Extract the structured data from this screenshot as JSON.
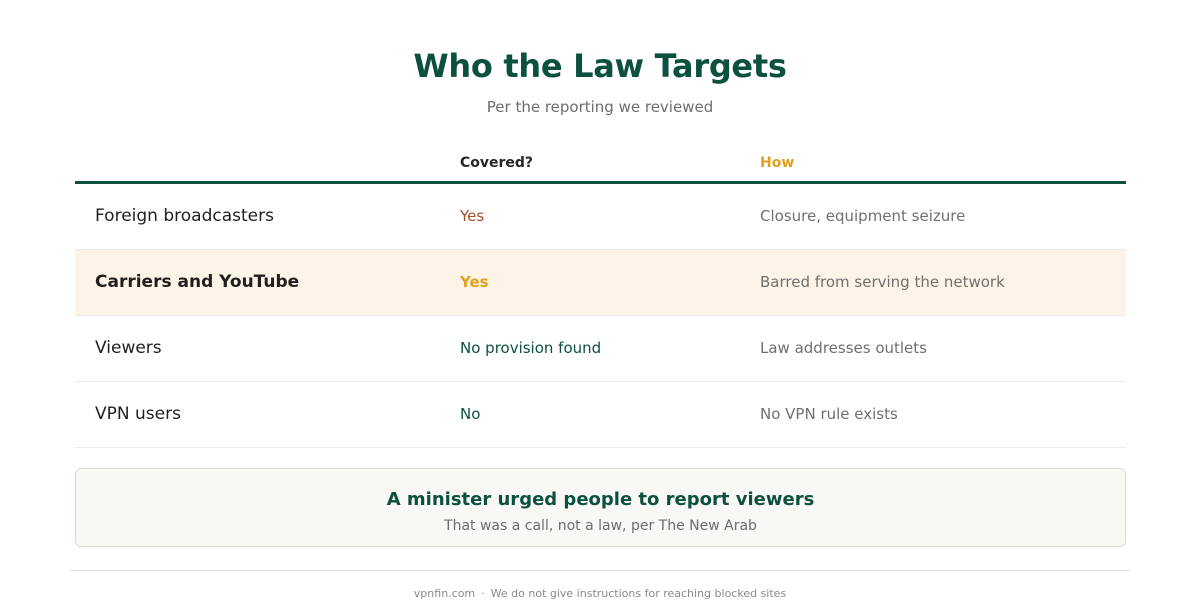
{
  "header": {
    "title": "Who the Law Targets",
    "subtitle": "Per the reporting we reviewed"
  },
  "table": {
    "columns": [
      "",
      "Covered?",
      "How"
    ],
    "rows": [
      {
        "target": "Foreign broadcasters",
        "covered": "Yes",
        "how": "Closure, equipment seizure"
      },
      {
        "target": "Carriers and YouTube",
        "covered": "Yes",
        "how": "Barred from serving the network"
      },
      {
        "target": "Viewers",
        "covered": "No provision found",
        "how": "Law addresses outlets"
      },
      {
        "target": "VPN users",
        "covered": "No",
        "how": "No VPN rule exists"
      }
    ]
  },
  "callout": {
    "title": "A minister urged people to report viewers",
    "text": "That was a call, not a law, per The New Arab"
  },
  "footer": {
    "site": "vpnfin.com",
    "separator": "·",
    "disclaimer": "We do not give instructions for reaching blocked sites"
  },
  "colors": {
    "brand_green": "#0c5040",
    "accent_amber": "#e0a024",
    "yes_rust": "#a0502a",
    "highlight_bg": "#fdf3e6"
  }
}
